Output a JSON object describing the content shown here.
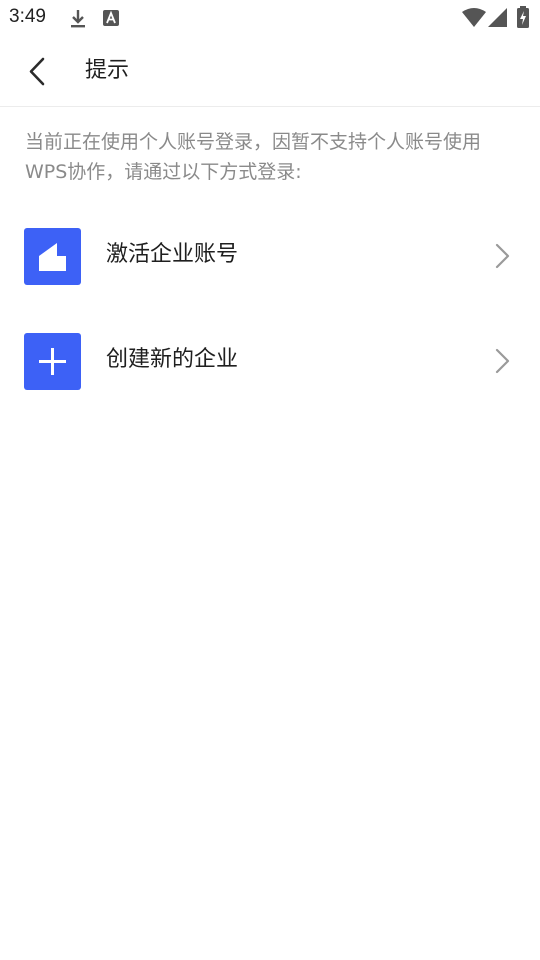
{
  "status_bar": {
    "time": "3:49",
    "icons": [
      "download-icon",
      "a-notification-icon",
      "wifi-icon",
      "signal-icon",
      "battery-charging-icon"
    ]
  },
  "header": {
    "title": "提示",
    "back_icon": "chevron-left-icon"
  },
  "hint": {
    "text": "当前正在使用个人账号登录，因暂不支持个人账号使用WPS协作，请通过以下方式登录:"
  },
  "options": [
    {
      "label": "激活企业账号",
      "icon": "building-icon",
      "chevron_icon": "chevron-right-icon"
    },
    {
      "label": "创建新的企业",
      "icon": "plus-icon",
      "chevron_icon": "chevron-right-icon"
    }
  ],
  "colors": {
    "accent": "#3d61f6",
    "title_text": "#1f1f1f",
    "hint_text": "#8a8a8a",
    "chevron": "#9a9a9a",
    "divider": "#ececec"
  }
}
